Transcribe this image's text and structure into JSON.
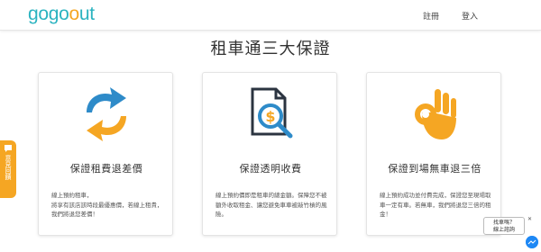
{
  "header": {
    "logo_prefix": "gogo",
    "logo_pin": "o",
    "logo_suffix": "ut",
    "register_label": "註冊",
    "login_label": "登入"
  },
  "page": {
    "title": "租車通三大保證"
  },
  "cards": [
    {
      "icon": "refresh-arrows-icon",
      "title": "保證租費退差價",
      "description": "線上預約租車，\n將享有該店該時段最優惠價，若線上租貴，我們將退您差價！"
    },
    {
      "icon": "document-dollar-magnifier-icon",
      "title": "保證透明收費",
      "description": "線上預約價即是租車的總金額。保障您不被額外收取租金、讓您避免車車被敲竹槓的風險。"
    },
    {
      "icon": "ok-hand-icon",
      "title": "保證到場無車退三倍",
      "description": "線上預約成功並付費完成，保證您至現場取車一定有車。若無車，我們將退您三倍的租金！"
    }
  ],
  "side_tab": {
    "label": "意見回饋"
  },
  "chat": {
    "line1": "找車嗎？",
    "line2": "線上諮詢",
    "close": "✕"
  },
  "colors": {
    "brand_teal": "#2bb3c0",
    "brand_orange": "#f5a623",
    "icon_blue": "#2e8bc9",
    "icon_dark": "#2b3440",
    "messenger_blue": "#1e88f5"
  }
}
